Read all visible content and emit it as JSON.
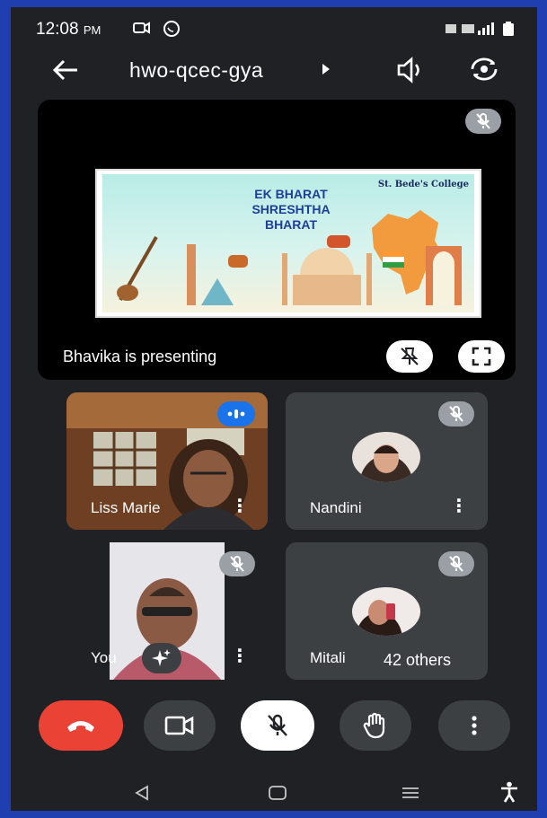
{
  "status_bar": {
    "time": "12:08",
    "ampm": "PM"
  },
  "meeting": {
    "code": "hwo-qcec-gya"
  },
  "presentation": {
    "status": "Bhavika is presenting",
    "slide_title": "EK BHARAT SHRESHTHA BHARAT",
    "slide_college": "St. Bede's College"
  },
  "participants": [
    {
      "name": "Liss Marie"
    },
    {
      "name": "Nandini"
    },
    {
      "name": "You"
    },
    {
      "name": "Mitali"
    }
  ],
  "others": {
    "label": "42 others"
  },
  "colors": {
    "end_call": "#ea4335",
    "speaking": "#1a73e8",
    "tile_bg": "#3c4043"
  }
}
